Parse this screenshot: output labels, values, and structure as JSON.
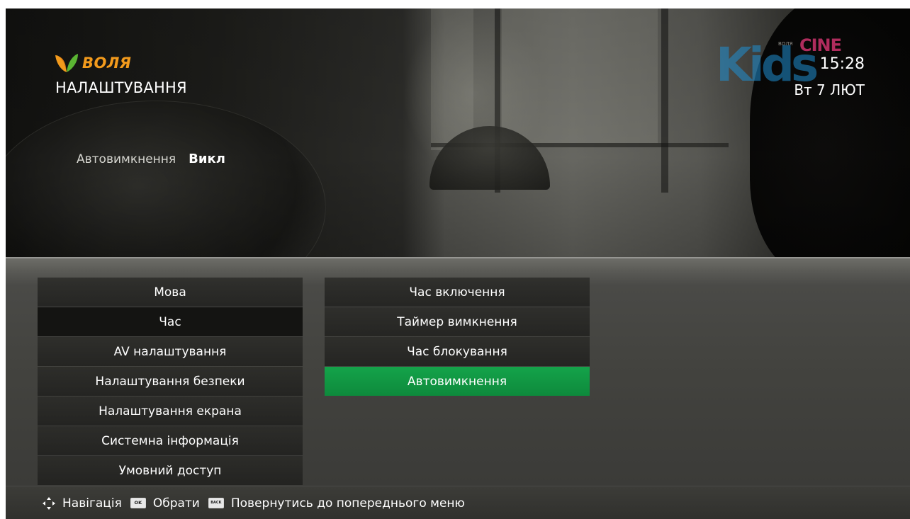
{
  "header": {
    "brand_name": "ВОЛЯ",
    "page_title": "НАЛАШТУВАННЯ",
    "current_setting": {
      "label": "Автовимкнення",
      "value": "Викл"
    },
    "channel_logo": {
      "kids": "Kids",
      "cine": "CINE",
      "small": "ВОЛЯ"
    },
    "time": "15:28",
    "date": "Вт 7 ЛЮТ"
  },
  "main_menu": {
    "items": [
      "Мова",
      "Час",
      "AV налаштування",
      "Налаштування безпеки",
      "Налаштування екрана",
      "Системна інформація",
      "Умовний доступ"
    ],
    "selected": "Час"
  },
  "sub_menu": {
    "items": [
      "Час включення",
      "Таймер вимкнення",
      "Час блокування",
      "Автовимкнення"
    ],
    "focused": "Автовимкнення"
  },
  "help_bar": {
    "navigation_label": "Навігація",
    "ok_key": "OK",
    "select_label": "Обрати",
    "back_key": "BACK",
    "back_label": "Повернутись до попереднього меню"
  },
  "colors": {
    "brand_orange": "#f29a1c",
    "focus_green": "#14a34a",
    "kids_blue": "#1f8fd1",
    "cine_pink": "#e8397a"
  },
  "icons": [
    "voya-leaf-logo",
    "dpad-arrows-icon",
    "ok-key-icon",
    "back-key-icon"
  ]
}
